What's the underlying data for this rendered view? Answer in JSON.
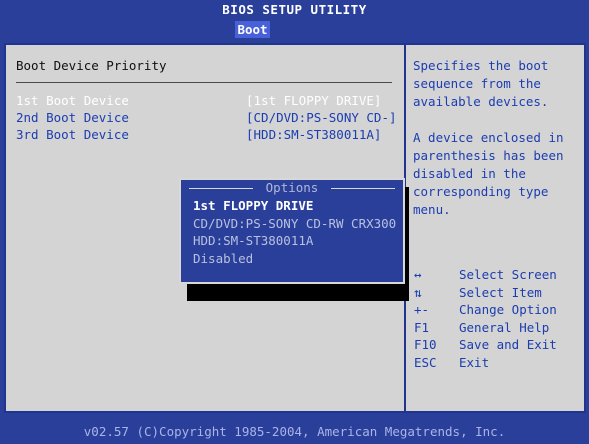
{
  "header": {
    "title": "BIOS SETUP UTILITY",
    "active_tab": "Boot"
  },
  "main": {
    "section_title": "Boot Device Priority",
    "boot_devices": [
      {
        "label": "1st Boot Device",
        "value": "[1st FLOPPY DRIVE]",
        "selected": true
      },
      {
        "label": "2nd Boot Device",
        "value": "[CD/DVD:PS-SONY CD-]",
        "selected": false
      },
      {
        "label": "3rd Boot Device",
        "value": "[HDD:SM-ST380011A]",
        "selected": false
      }
    ]
  },
  "help": {
    "text": "Specifies the boot\nsequence from the\navailable devices.\n\nA device enclosed in\nparenthesis has been\ndisabled in the\ncorresponding type\nmenu."
  },
  "keys": [
    {
      "key": "↔",
      "desc": "Select Screen"
    },
    {
      "key": "⇅",
      "desc": "Select Item"
    },
    {
      "key": "+-",
      "desc": "Change Option"
    },
    {
      "key": "F1",
      "desc": "General Help"
    },
    {
      "key": "F10",
      "desc": "Save and Exit"
    },
    {
      "key": "ESC",
      "desc": "Exit"
    }
  ],
  "options_popup": {
    "title": "Options",
    "items": [
      {
        "label": "1st FLOPPY DRIVE",
        "selected": true
      },
      {
        "label": "CD/DVD:PS-SONY CD-RW CRX300",
        "selected": false
      },
      {
        "label": "HDD:SM-ST380011A",
        "selected": false
      },
      {
        "label": "Disabled",
        "selected": false
      }
    ]
  },
  "footer": {
    "copyright": "v02.57 (C)Copyright 1985-2004, American Megatrends, Inc."
  },
  "colors": {
    "background_blue": "#2a3f9a",
    "panel_gray": "#d4d4d4",
    "text_blue": "#1c3db0",
    "active_tab": "#4860d8"
  }
}
